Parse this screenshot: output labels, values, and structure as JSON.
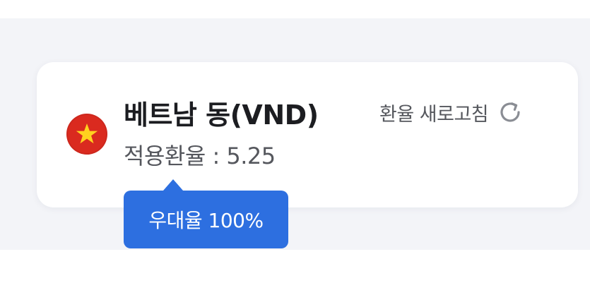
{
  "currency": {
    "name": "베트남 동(VND)",
    "rate_label": "적용환율",
    "rate_separator": " : ",
    "rate_value": "5.25",
    "flag_icon": "vietnam-flag-icon"
  },
  "refresh": {
    "label": "환율 새로고침",
    "icon": "refresh-icon"
  },
  "tooltip": {
    "text": "우대율 100%"
  },
  "colors": {
    "background": "#f3f4f8",
    "card": "#ffffff",
    "flag_red": "#da2a1f",
    "flag_star": "#ffd21f",
    "tooltip": "#2d6fe0",
    "text_primary": "#1c1d21",
    "text_secondary": "#55575d",
    "icon_gray": "#8a8d94"
  }
}
